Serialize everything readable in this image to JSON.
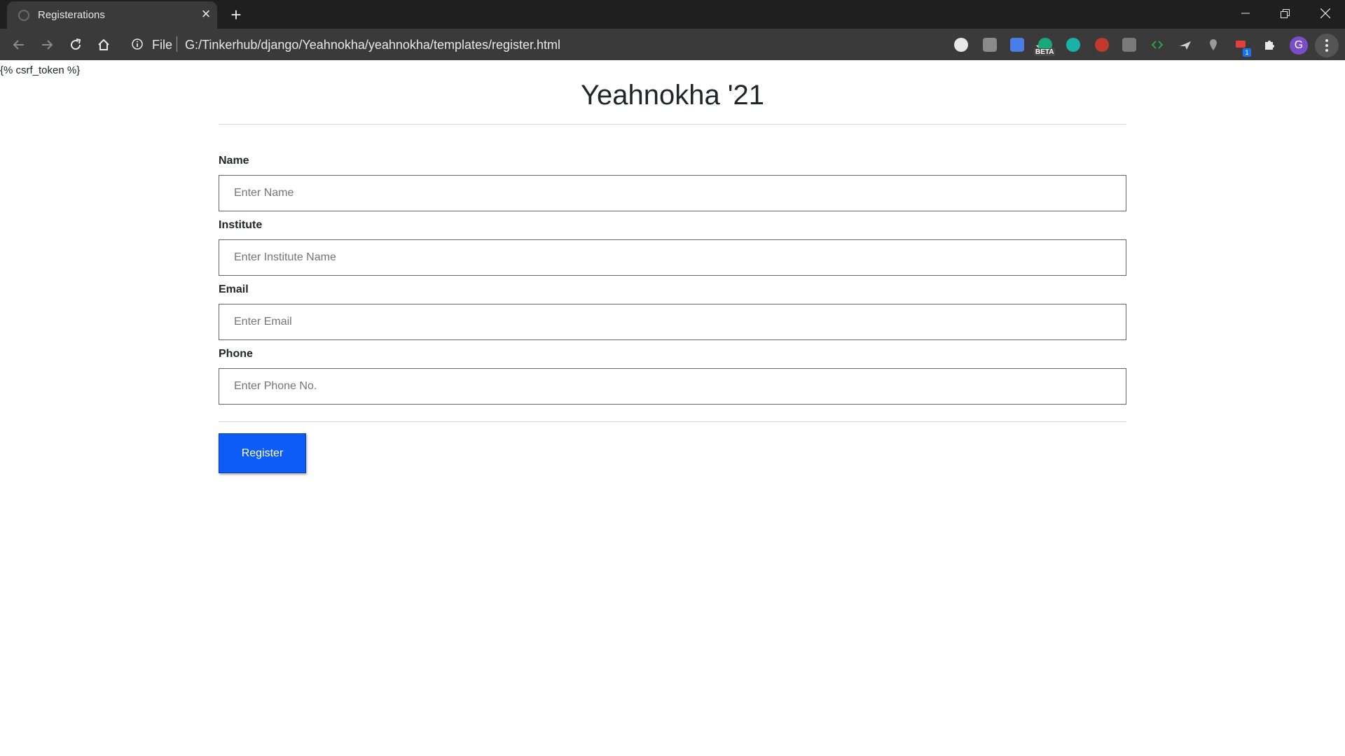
{
  "browser": {
    "tab_title": "Registerations",
    "scheme_label": "File",
    "url": "G:/Tinkerhub/django/Yeahnokha/yeahnokha/templates/register.html",
    "extension_badge": "BETA",
    "notification_count": "1",
    "profile_initial": "G"
  },
  "page": {
    "csrf_text": "{% csrf_token %}",
    "title": "Yeahnokha '21",
    "fields": [
      {
        "label": "Name",
        "placeholder": "Enter Name"
      },
      {
        "label": "Institute",
        "placeholder": "Enter Institute Name"
      },
      {
        "label": "Email",
        "placeholder": "Enter Email"
      },
      {
        "label": "Phone",
        "placeholder": "Enter Phone No."
      }
    ],
    "register_label": "Register"
  },
  "colors": {
    "button": "#0d5cf7",
    "chrome_bg": "#3a3a3a",
    "tabstrip_bg": "#1f1f1f"
  }
}
